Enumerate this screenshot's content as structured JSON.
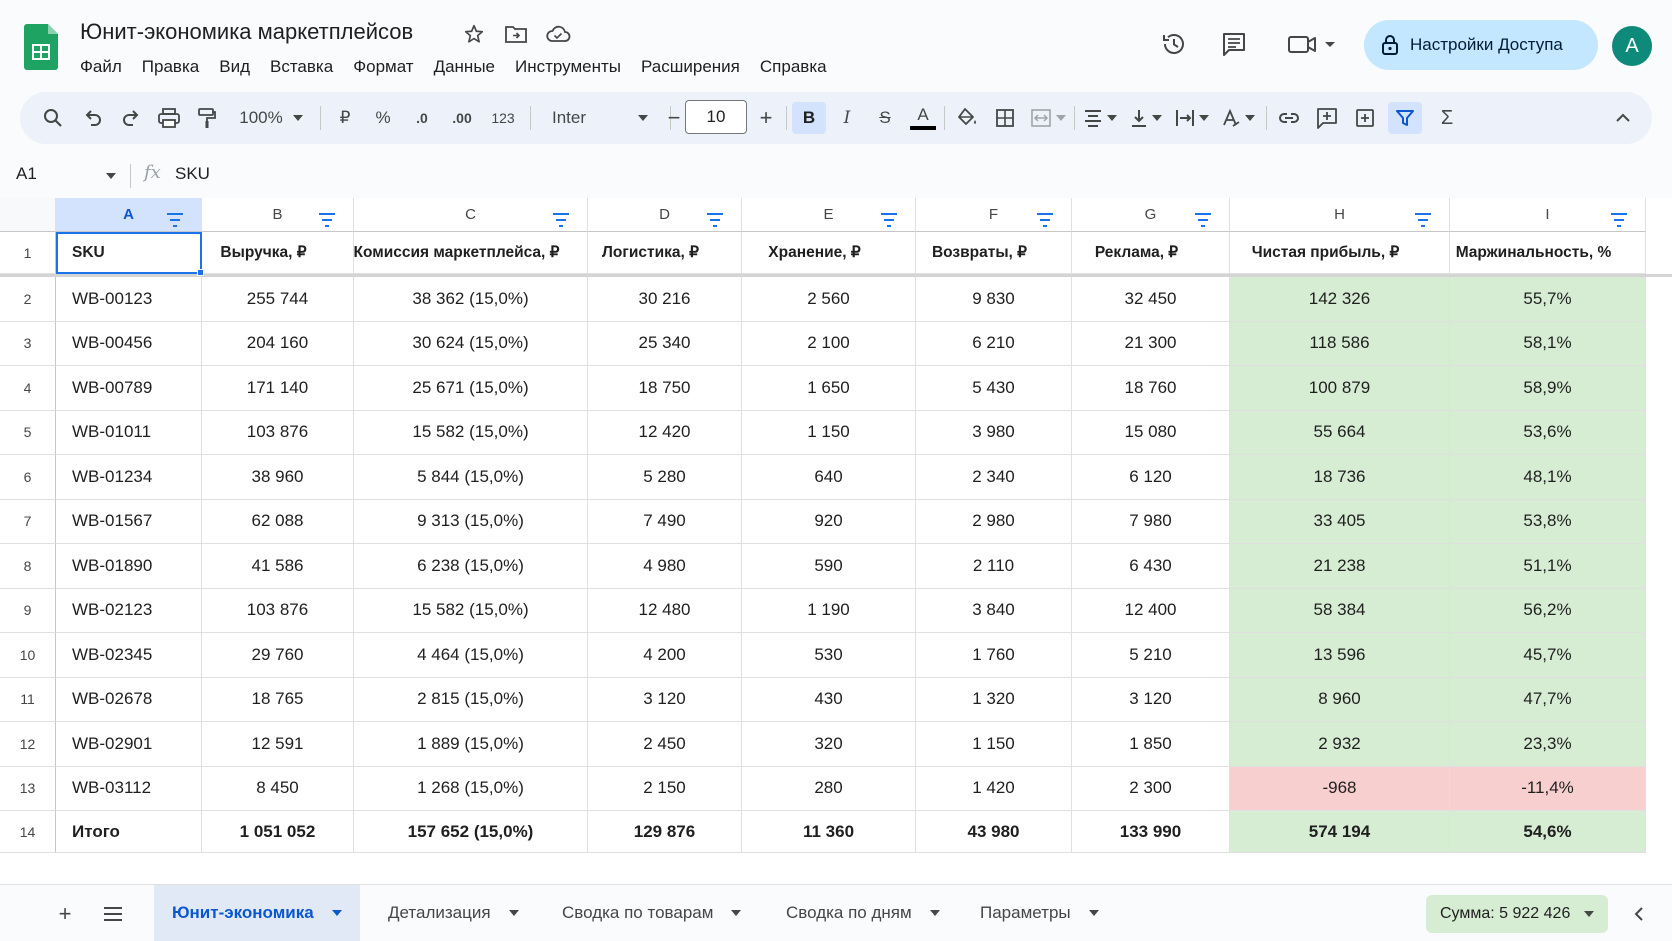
{
  "app": {
    "doc_title": "Юнит-экономика маркетплейсов",
    "menu": [
      "Файл",
      "Правка",
      "Вид",
      "Вставка",
      "Формат",
      "Данные",
      "Инструменты",
      "Расширения",
      "Справка"
    ],
    "share_label": "Настройки Доступа",
    "avatar_letter": "A"
  },
  "toolbar": {
    "zoom": "100%",
    "currency": "₽",
    "percent": "%",
    "dec_minus": ".0",
    "dec_plus": ".00",
    "number_format": "123",
    "font_name": "Inter",
    "font_size": "10",
    "bold": "B",
    "italic": "I",
    "strike": "S",
    "text_color": "A",
    "sum_icon": "Σ"
  },
  "formula_bar": {
    "name_box": "A1",
    "fx": "fx",
    "value": "SKU"
  },
  "grid": {
    "column_letters": [
      "A",
      "B",
      "C",
      "D",
      "E",
      "F",
      "G",
      "H",
      "I"
    ],
    "row_numbers": [
      "1",
      "2",
      "3",
      "4",
      "5",
      "6",
      "7",
      "8",
      "9",
      "10",
      "11",
      "12",
      "13",
      "14"
    ],
    "headers": [
      "SKU",
      "Выручка, ₽",
      "Комиссия маркетплейса, ₽",
      "Логистика, ₽",
      "Хранение, ₽",
      "Возвраты, ₽",
      "Реклама, ₽",
      "Чистая прибыль, ₽",
      "Маржинальность, %"
    ],
    "rows": [
      [
        "WB-00123",
        "255 744",
        "38 362 (15,0%)",
        "30 216",
        "2 560",
        "9 830",
        "32 450",
        "142 326",
        "55,7%"
      ],
      [
        "WB-00456",
        "204 160",
        "30 624 (15,0%)",
        "25 340",
        "2 100",
        "6 210",
        "21 300",
        "118 586",
        "58,1%"
      ],
      [
        "WB-00789",
        "171 140",
        "25 671 (15,0%)",
        "18 750",
        "1 650",
        "5 430",
        "18 760",
        "100 879",
        "58,9%"
      ],
      [
        "WB-01011",
        "103 876",
        "15 582 (15,0%)",
        "12 420",
        "1 150",
        "3 980",
        "15 080",
        "55 664",
        "53,6%"
      ],
      [
        "WB-01234",
        "38 960",
        "5 844 (15,0%)",
        "5 280",
        "640",
        "2 340",
        "6 120",
        "18 736",
        "48,1%"
      ],
      [
        "WB-01567",
        "62 088",
        "9 313 (15,0%)",
        "7 490",
        "920",
        "2 980",
        "7 980",
        "33 405",
        "53,8%"
      ],
      [
        "WB-01890",
        "41 586",
        "6 238 (15,0%)",
        "4 980",
        "590",
        "2 110",
        "6 430",
        "21 238",
        "51,1%"
      ],
      [
        "WB-02123",
        "103 876",
        "15 582 (15,0%)",
        "12 480",
        "1 190",
        "3 840",
        "12 400",
        "58 384",
        "56,2%"
      ],
      [
        "WB-02345",
        "29 760",
        "4 464 (15,0%)",
        "4 200",
        "530",
        "1 760",
        "5 210",
        "13 596",
        "45,7%"
      ],
      [
        "WB-02678",
        "18 765",
        "2 815 (15,0%)",
        "3 120",
        "430",
        "1 320",
        "3 120",
        "8 960",
        "47,7%"
      ],
      [
        "WB-02901",
        "12 591",
        "1 889 (15,0%)",
        "2 450",
        "320",
        "1 150",
        "1 850",
        "2 932",
        "23,3%"
      ],
      [
        "WB-03112",
        "8 450",
        "1 268 (15,0%)",
        "2 150",
        "280",
        "1 420",
        "2 300",
        "-968",
        "-11,4%"
      ]
    ],
    "total": [
      "Итого",
      "1 051 052",
      "157 652 (15,0%)",
      "129 876",
      "11 360",
      "43 980",
      "133 990",
      "574 194",
      "54,6%"
    ],
    "negative_row_index": 11,
    "colors": {
      "positive_fill": "#d6edd4",
      "negative_fill": "#f7cfcf",
      "selection": "#1a73e8"
    }
  },
  "sheets": {
    "tabs": [
      "Юнит-экономика",
      "Детализация",
      "Сводка по товарам",
      "Сводка по дням",
      "Параметры"
    ],
    "active_index": 0,
    "sum_label": "Сумма: 5 922 426"
  }
}
